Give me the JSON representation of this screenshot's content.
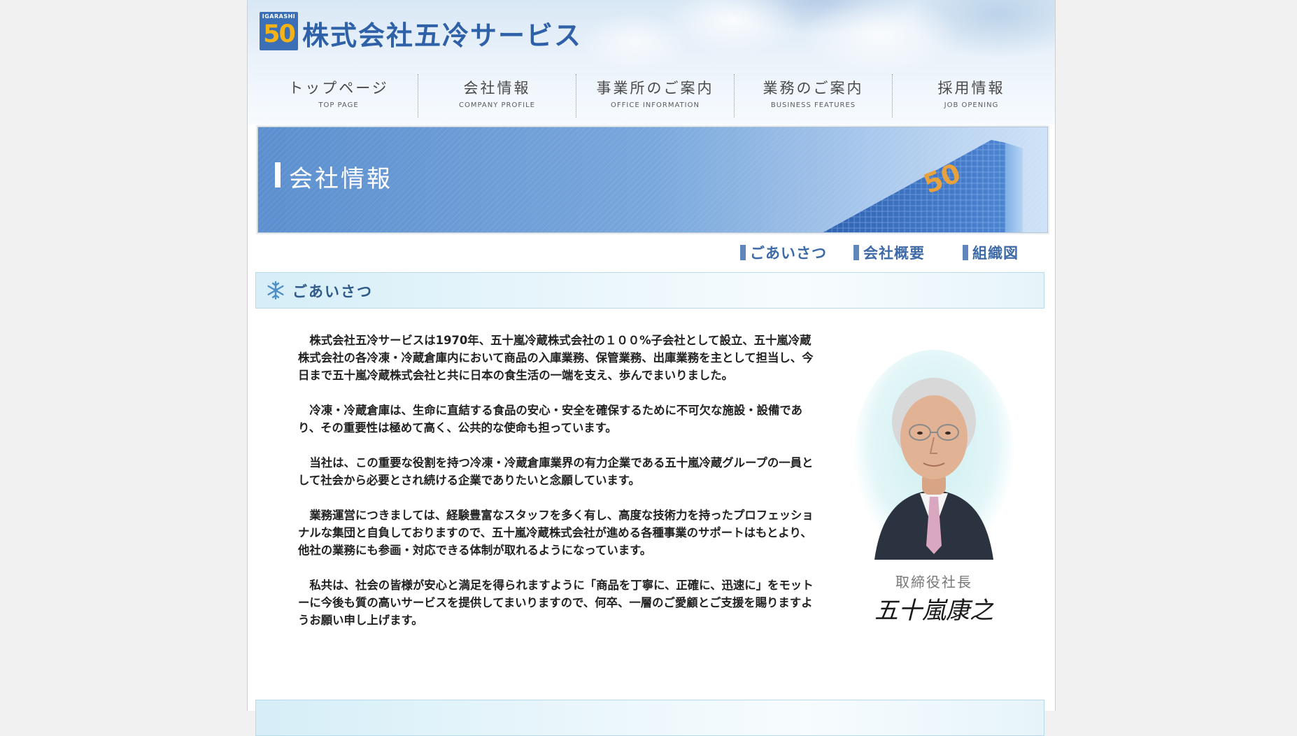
{
  "header": {
    "logo_mini": "IGARASHI",
    "logo_number": "50",
    "company_name": "株式会社五冷サービス"
  },
  "nav": [
    {
      "jp": "トップページ",
      "en": "TOP PAGE"
    },
    {
      "jp": "会社情報",
      "en": "COMPANY PROFILE"
    },
    {
      "jp": "事業所のご案内",
      "en": "OFFICE INFORMATION"
    },
    {
      "jp": "業務のご案内",
      "en": "BUSINESS FEATURES"
    },
    {
      "jp": "採用情報",
      "en": "JOB OPENING"
    }
  ],
  "banner": {
    "title": "会社情報",
    "building_number": "50"
  },
  "subnav": [
    {
      "label": "ごあいさつ"
    },
    {
      "label": "会社概要"
    },
    {
      "label": "組織図"
    }
  ],
  "section": {
    "title": "ごあいさつ"
  },
  "message": {
    "paragraphs": [
      "株式会社五冷サービスは1970年、五十嵐冷蔵株式会社の１００%子会社として設立、五十嵐冷蔵株式会社の各冷凍・冷蔵倉庫内において商品の入庫業務、保管業務、出庫業務を主として担当し、今日まで五十嵐冷蔵株式会社と共に日本の食生活の一端を支え、歩んでまいりました。",
      "冷凍・冷蔵倉庫は、生命に直結する食品の安心・安全を確保するために不可欠な施設・設備であり、その重要性は極めて高く、公共的な使命も担っています。",
      "当社は、この重要な役割を持つ冷凍・冷蔵倉庫業界の有力企業である五十嵐冷蔵グループの一員として社会から必要とされ続ける企業でありたいと念願しています。",
      "業務運営につきましては、経験豊富なスタッフを多く有し、高度な技術力を持ったプロフェッショナルな集団と自負しておりますので、五十嵐冷蔵株式会社が進める各種事業のサポートはもとより、他社の業務にも参画・対応できる体制が取れるようになっています。",
      "私共は、社会の皆様が安心と満足を得られますように「商品を丁寧に、正確に、迅速に」をモットーに今後も質の高いサービスを提供してまいりますので、何卒、一層のご愛顧とご支援を賜りますようお願い申し上げます。"
    ]
  },
  "president": {
    "title": "取締役社長",
    "signature": "五十嵐康之"
  },
  "colors": {
    "brand_blue": "#2f61a8",
    "logo_orange": "#f6b315",
    "subnav_blue": "#3f6aa8",
    "section_title": "#2f5a8a"
  },
  "icons": {
    "section": "snowflake-icon"
  }
}
